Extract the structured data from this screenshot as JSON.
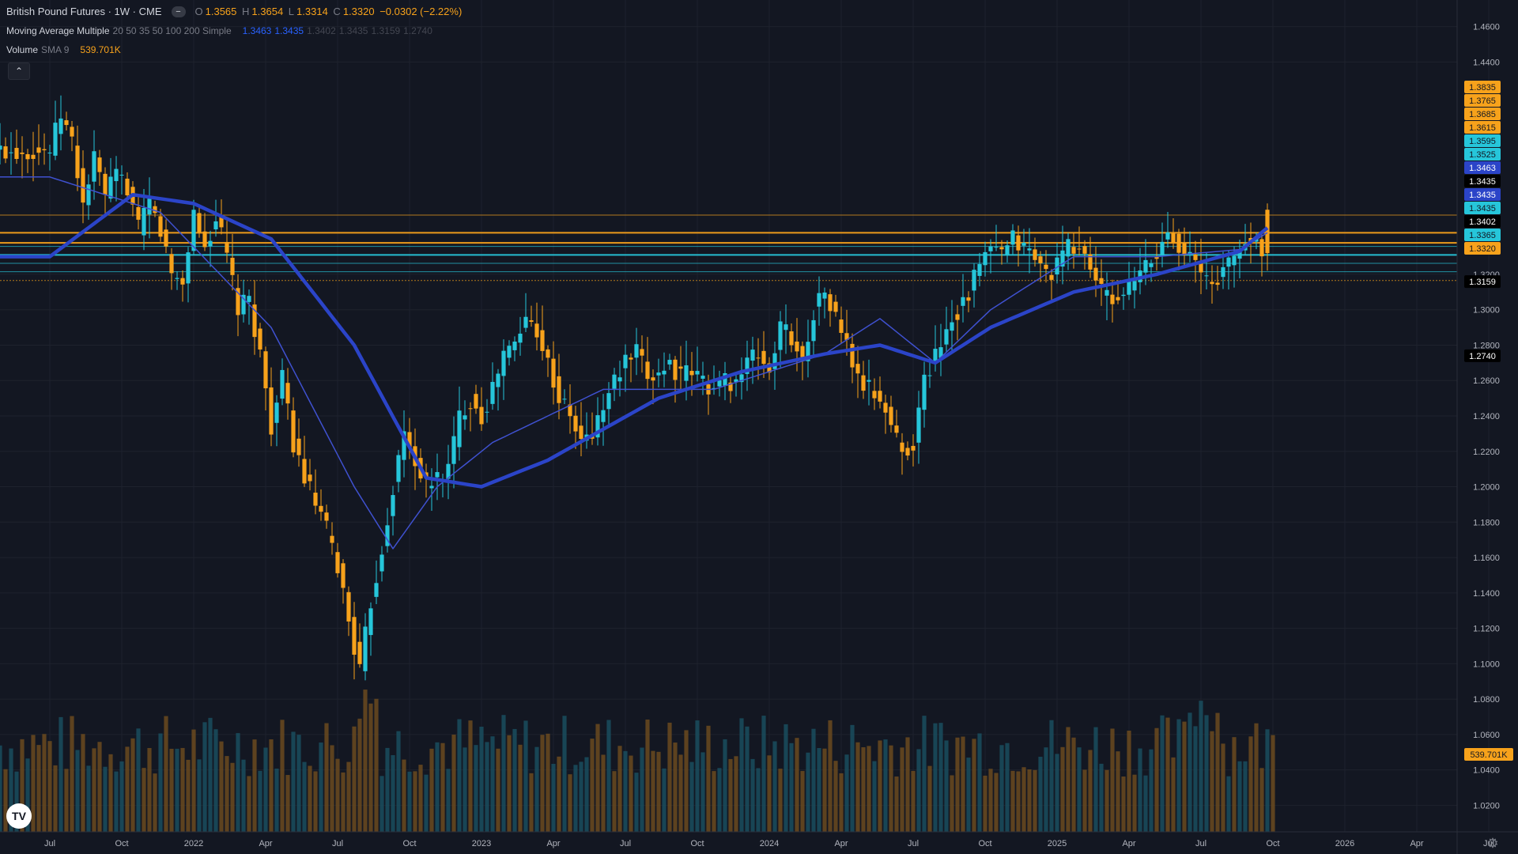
{
  "header": {
    "symbol": "British Pound Futures · 1W · CME",
    "ohlc": {
      "o_label": "O",
      "o": "1.3565",
      "h_label": "H",
      "h": "1.3654",
      "l_label": "L",
      "l": "1.3314",
      "c_label": "C",
      "c": "1.3320",
      "change": "−0.0302 (−2.22%)"
    },
    "ma_indicator": {
      "name": "Moving Average Multiple",
      "params": "20 50 35 50 100 200 Simple",
      "values": [
        "1.3463",
        "1.3435",
        "1.3402",
        "1.3435",
        "1.3159",
        "1.2740"
      ]
    },
    "volume_indicator": {
      "name": "Volume",
      "params": "SMA 9",
      "value": "539.701K"
    }
  },
  "colors": {
    "background": "#131722",
    "up": "#22ab94",
    "candle_up": "#26c6da",
    "candle_down": "#f7a21b",
    "ma_thin": "#3f51d0",
    "ma_thick": "#2b44c8",
    "level_orange": "#f7a21b",
    "level_cyan": "#26c6da",
    "grid": "#1e222d",
    "axis_text": "#b2b5be"
  },
  "icons": {
    "collapse": "chevron-up-icon",
    "logo": "tradingview-logo",
    "settings": "gear-icon"
  },
  "chart_data": {
    "type": "candlestick",
    "title": "British Pound Futures · 1W · CME",
    "ylim": [
      1.005,
      1.475
    ],
    "y_ticks": [
      "1.4600",
      "1.4400",
      "1.3200",
      "1.3000",
      "1.2800",
      "1.2600",
      "1.2400",
      "1.2200",
      "1.2000",
      "1.1800",
      "1.1600",
      "1.1400",
      "1.1200",
      "1.1000",
      "1.0800",
      "1.0600",
      "1.0400",
      "1.0200"
    ],
    "y_tick_values": [
      1.46,
      1.44,
      1.32,
      1.3,
      1.28,
      1.26,
      1.24,
      1.22,
      1.2,
      1.18,
      1.16,
      1.14,
      1.12,
      1.1,
      1.08,
      1.06,
      1.04,
      1.02
    ],
    "x_ticks": [
      "Jul",
      "Oct",
      "2022",
      "Apr",
      "Jul",
      "Oct",
      "2023",
      "Apr",
      "Jul",
      "Oct",
      "2024",
      "Apr",
      "Jul",
      "Oct",
      "2025",
      "Apr",
      "Jul",
      "Oct",
      "2026",
      "Apr",
      "Jul"
    ],
    "x_tick_weeks": [
      0,
      13,
      26,
      39,
      52,
      65,
      78,
      91,
      104,
      117,
      130,
      143,
      156,
      169,
      182,
      195,
      208,
      221,
      234,
      247,
      260
    ],
    "grid": true,
    "price_scale_labels": [
      {
        "text": "1.3835",
        "value": 1.3835,
        "style": "orange"
      },
      {
        "text": "1.3765",
        "value": 1.3765,
        "style": "orange"
      },
      {
        "text": "1.3685",
        "value": 1.3685,
        "style": "orange"
      },
      {
        "text": "1.3615",
        "value": 1.3615,
        "style": "orange"
      },
      {
        "text": "1.3595",
        "value": 1.3595,
        "style": "cyan"
      },
      {
        "text": "1.3525",
        "value": 1.3525,
        "style": "cyan"
      },
      {
        "text": "1.3463",
        "value": 1.3463,
        "style": "blue"
      },
      {
        "text": "1.3435",
        "value": 1.3435,
        "style": "black"
      },
      {
        "text": "1.3435",
        "value": 1.3435,
        "style": "blue"
      },
      {
        "text": "1.3435",
        "value": 1.3435,
        "style": "cyan"
      },
      {
        "text": "1.3402",
        "value": 1.3402,
        "style": "black"
      },
      {
        "text": "1.3365",
        "value": 1.3365,
        "style": "cyan"
      },
      {
        "text": "1.3320",
        "value": 1.332,
        "style": "orange"
      },
      {
        "text": "1.3159",
        "value": 1.3159,
        "style": "black"
      },
      {
        "text": "1.2740",
        "value": 1.274,
        "style": "black"
      },
      {
        "text": "539.701K",
        "value": null,
        "style": "orange"
      }
    ],
    "horizontal_levels": [
      {
        "value": 1.3535,
        "color": "orange",
        "width": 1
      },
      {
        "value": 1.3435,
        "color": "orange",
        "width": 2
      },
      {
        "value": 1.3378,
        "color": "orange",
        "width": 2
      },
      {
        "value": 1.3358,
        "color": "cyan",
        "width": 1
      },
      {
        "value": 1.331,
        "color": "cyan",
        "width": 2
      },
      {
        "value": 1.3262,
        "color": "cyan",
        "width": 1
      },
      {
        "value": 1.3215,
        "color": "cyan",
        "width": 1
      },
      {
        "value": 1.3165,
        "color": "orange",
        "width": 1,
        "dotted": true
      }
    ],
    "price_path": [
      [
        0,
        1.39
      ],
      [
        2,
        1.41
      ],
      [
        4,
        1.395
      ],
      [
        6,
        1.36
      ],
      [
        8,
        1.385
      ],
      [
        10,
        1.365
      ],
      [
        12,
        1.375
      ],
      [
        14,
        1.37
      ],
      [
        16,
        1.345
      ],
      [
        18,
        1.36
      ],
      [
        20,
        1.345
      ],
      [
        22,
        1.32
      ],
      [
        24,
        1.315
      ],
      [
        26,
        1.355
      ],
      [
        28,
        1.335
      ],
      [
        30,
        1.352
      ],
      [
        32,
        1.33
      ],
      [
        34,
        1.3
      ],
      [
        36,
        1.305
      ],
      [
        38,
        1.275
      ],
      [
        40,
        1.235
      ],
      [
        42,
        1.26
      ],
      [
        44,
        1.225
      ],
      [
        46,
        1.205
      ],
      [
        48,
        1.19
      ],
      [
        50,
        1.175
      ],
      [
        52,
        1.155
      ],
      [
        54,
        1.125
      ],
      [
        56,
        1.095
      ],
      [
        58,
        1.135
      ],
      [
        60,
        1.165
      ],
      [
        62,
        1.2
      ],
      [
        64,
        1.23
      ],
      [
        66,
        1.215
      ],
      [
        68,
        1.2
      ],
      [
        70,
        1.205
      ],
      [
        72,
        1.21
      ],
      [
        74,
        1.24
      ],
      [
        76,
        1.25
      ],
      [
        78,
        1.24
      ],
      [
        80,
        1.255
      ],
      [
        82,
        1.275
      ],
      [
        84,
        1.28
      ],
      [
        86,
        1.295
      ],
      [
        88,
        1.29
      ],
      [
        90,
        1.27
      ],
      [
        92,
        1.25
      ],
      [
        94,
        1.24
      ],
      [
        96,
        1.225
      ],
      [
        98,
        1.23
      ],
      [
        100,
        1.245
      ],
      [
        102,
        1.26
      ],
      [
        104,
        1.27
      ],
      [
        106,
        1.275
      ],
      [
        108,
        1.262
      ],
      [
        110,
        1.265
      ],
      [
        112,
        1.27
      ],
      [
        114,
        1.262
      ],
      [
        116,
        1.265
      ],
      [
        118,
        1.26
      ],
      [
        120,
        1.255
      ],
      [
        122,
        1.26
      ],
      [
        124,
        1.26
      ],
      [
        126,
        1.27
      ],
      [
        128,
        1.275
      ],
      [
        130,
        1.265
      ],
      [
        132,
        1.29
      ],
      [
        134,
        1.285
      ],
      [
        136,
        1.27
      ],
      [
        138,
        1.3
      ],
      [
        140,
        1.31
      ],
      [
        142,
        1.295
      ],
      [
        144,
        1.28
      ],
      [
        146,
        1.26
      ],
      [
        148,
        1.255
      ],
      [
        150,
        1.25
      ],
      [
        152,
        1.235
      ],
      [
        154,
        1.22
      ],
      [
        156,
        1.225
      ],
      [
        158,
        1.26
      ],
      [
        160,
        1.275
      ],
      [
        162,
        1.29
      ],
      [
        164,
        1.3
      ],
      [
        166,
        1.31
      ],
      [
        168,
        1.325
      ],
      [
        170,
        1.335
      ],
      [
        172,
        1.33
      ],
      [
        174,
        1.34
      ],
      [
        176,
        1.335
      ],
      [
        178,
        1.33
      ],
      [
        180,
        1.32
      ],
      [
        182,
        1.325
      ],
      [
        184,
        1.335
      ],
      [
        186,
        1.335
      ],
      [
        188,
        1.325
      ],
      [
        190,
        1.31
      ],
      [
        192,
        1.305
      ],
      [
        194,
        1.31
      ],
      [
        196,
        1.315
      ],
      [
        198,
        1.325
      ],
      [
        200,
        1.33
      ],
      [
        202,
        1.345
      ],
      [
        204,
        1.338
      ],
      [
        206,
        1.33
      ],
      [
        208,
        1.32
      ],
      [
        210,
        1.315
      ],
      [
        212,
        1.322
      ],
      [
        214,
        1.33
      ],
      [
        216,
        1.338
      ],
      [
        218,
        1.34
      ],
      [
        220,
        1.332
      ]
    ],
    "series": [
      {
        "name": "20",
        "values_by_week": [
          [
            0,
            1.375
          ],
          [
            20,
            1.355
          ],
          [
            40,
            1.29
          ],
          [
            55,
            1.2
          ],
          [
            62,
            1.165
          ],
          [
            70,
            1.2
          ],
          [
            80,
            1.225
          ],
          [
            100,
            1.255
          ],
          [
            120,
            1.255
          ],
          [
            140,
            1.275
          ],
          [
            150,
            1.295
          ],
          [
            160,
            1.27
          ],
          [
            170,
            1.3
          ],
          [
            185,
            1.33
          ],
          [
            200,
            1.33
          ],
          [
            215,
            1.334
          ],
          [
            220,
            1.3435
          ]
        ]
      },
      {
        "name": "50",
        "values_by_week": [
          [
            0,
            1.33
          ],
          [
            15,
            1.365
          ],
          [
            26,
            1.36
          ],
          [
            40,
            1.34
          ],
          [
            55,
            1.28
          ],
          [
            68,
            1.205
          ],
          [
            78,
            1.2
          ],
          [
            90,
            1.215
          ],
          [
            110,
            1.25
          ],
          [
            125,
            1.265
          ],
          [
            140,
            1.275
          ],
          [
            150,
            1.28
          ],
          [
            160,
            1.27
          ],
          [
            170,
            1.29
          ],
          [
            185,
            1.31
          ],
          [
            200,
            1.32
          ],
          [
            215,
            1.333
          ],
          [
            220,
            1.3463
          ]
        ]
      }
    ],
    "volume": {
      "name": "Volume",
      "sma_length": 9,
      "last_value": "539.701K"
    }
  }
}
